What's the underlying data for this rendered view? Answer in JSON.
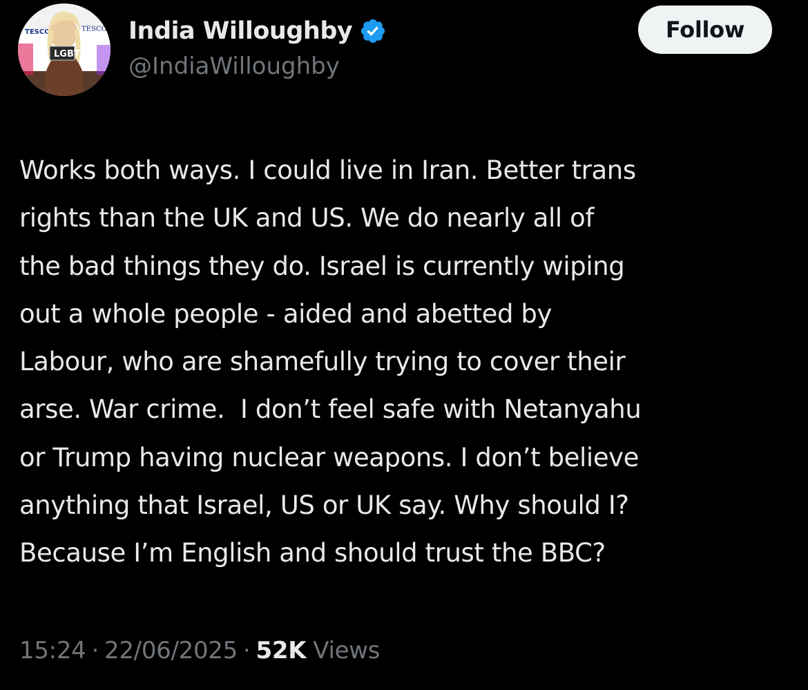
{
  "author": {
    "display_name": "India Willoughby",
    "handle": "@IndiaWilloughby",
    "verified": true,
    "avatar_banner_text": [
      "TESCO",
      "TESCO",
      "LGBT"
    ]
  },
  "follow_button": {
    "label": "Follow"
  },
  "tweet": {
    "text_lines": [
      "Works both ways. I could live in Iran. Better trans",
      "rights than the UK and US. We do nearly all of",
      "the bad things they do. Israel is currently wiping",
      "out a whole people - aided and abetted by",
      "Labour, who are shamefully trying to cover their",
      "arse. War crime.  I don’t feel safe with Netanyahu",
      "or Trump having nuclear weapons. I don’t believe",
      "anything that Israel, US or UK say. Why should I?",
      "Because I’m English and should trust the BBC?"
    ]
  },
  "meta": {
    "time": "15:24",
    "separator": "·",
    "date": "22/06/2025",
    "views_count": "52K",
    "views_label": "Views"
  },
  "colors": {
    "background": "#000000",
    "primary_text": "#e7e9ea",
    "secondary_text": "#71767b",
    "verified_blue": "#1d9bf0",
    "follow_bg": "#eff3f4",
    "follow_text": "#0f1419"
  },
  "icons": {
    "verified": "verified-badge-icon"
  }
}
